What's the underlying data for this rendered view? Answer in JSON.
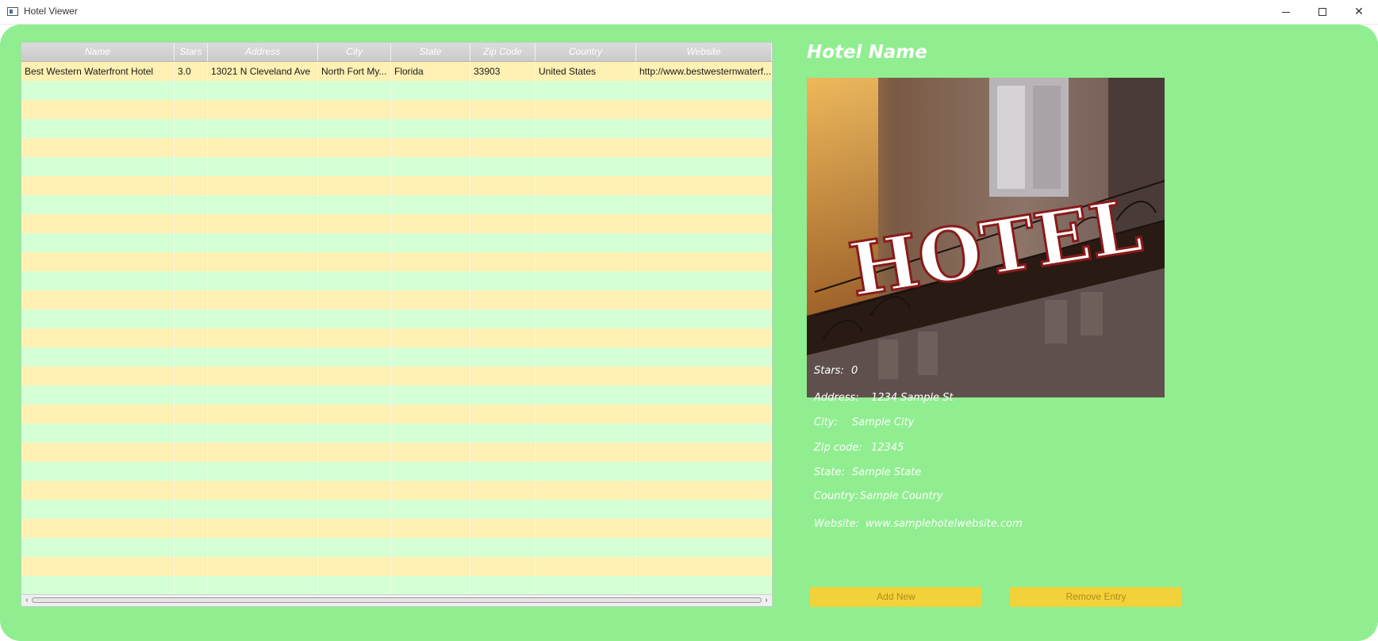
{
  "window": {
    "title": "Hotel Viewer"
  },
  "table": {
    "columns": [
      "Name",
      "Stars",
      "Address",
      "City",
      "State",
      "Zip Code",
      "Country",
      "Website"
    ],
    "rows": [
      [
        "Best Western Waterfront Hotel",
        "3.0",
        "13021 N Cleveland Ave",
        "North Fort My...",
        "Florida",
        "33903",
        "United States",
        "http://www.bestwesternwaterf..."
      ]
    ],
    "row_colors": {
      "odd": "#fff0b3",
      "even": "#d5ffd5"
    }
  },
  "detail": {
    "title": "Hotel Name",
    "image_text": "HOTEL",
    "stars_label": "Stars:",
    "stars_value": "0",
    "address_label": "Address:",
    "address_value": "1234 Sample St",
    "city_label": "City:",
    "city_value": "Sample City",
    "zip_label": "Zip code:",
    "zip_value": "12345",
    "state_label": "State:",
    "state_value": "Sample State",
    "country_label": "Country:",
    "country_value": "Sample Country",
    "website_label": "Website:",
    "website_value": "www.samplehotelwebsite.com"
  },
  "buttons": {
    "add_label": "Add New",
    "remove_label": "Remove Entry"
  },
  "colors": {
    "panel": "#90ee90",
    "button": "#f2d23a"
  }
}
